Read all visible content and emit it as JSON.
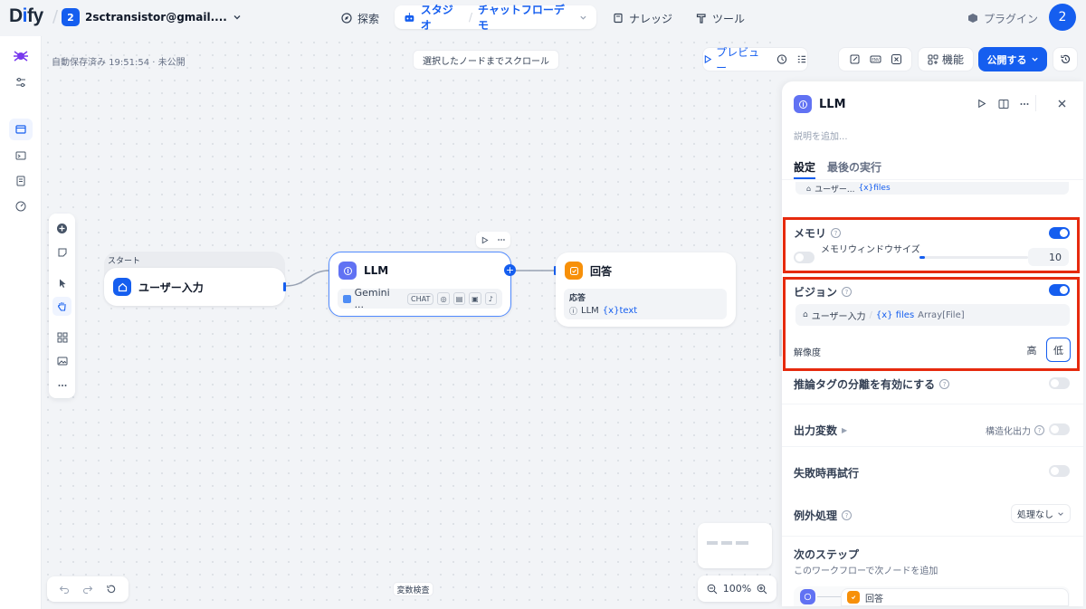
{
  "app": {
    "logo": "Dify"
  },
  "workspace": {
    "badge": "2",
    "name": "2sctransistor@gmail...."
  },
  "nav": {
    "explore": "探索",
    "studio": "スタジオ",
    "app_name": "チャットフローデモ",
    "knowledge": "ナレッジ",
    "tools": "ツール",
    "plugins": "プラグイン"
  },
  "user": {
    "avatar": "2"
  },
  "canvas": {
    "autosave": "自動保存済み 19:51:54 · 未公開",
    "scroll_to_node": "選択したノードまでスクロール",
    "var_inspect": "変数検査",
    "zoom": "100%"
  },
  "toolbar": {
    "preview": "プレビュー",
    "features": "機能",
    "publish": "公開する"
  },
  "nodes": {
    "start": {
      "header": "スタート",
      "title": "ユーザー入力"
    },
    "llm": {
      "title": "LLM",
      "model": "Gemini ...",
      "mode": "CHAT"
    },
    "answer": {
      "title": "回答",
      "field_label": "応答",
      "source": "LLM",
      "var": "{x}text"
    }
  },
  "panel": {
    "title": "LLM",
    "description_placeholder": "説明を追加...",
    "tabs": {
      "settings": "設定",
      "last_run": "最後の実行"
    },
    "context_snippet": {
      "node": "ユーザー...",
      "var": "{x}files"
    },
    "memory": {
      "label": "メモリ",
      "window_label": "メモリウィンドウサイズ",
      "window_value": "10",
      "window_fraction": 0.0
    },
    "vision": {
      "label": "ビジョン",
      "var_node": "ユーザー入力",
      "var_name": "{x} files",
      "var_type": "Array[File]",
      "resolution_label": "解像度",
      "high": "高",
      "low": "低"
    },
    "reasoning_tag": {
      "label": "推論タグの分離を有効にする"
    },
    "output_vars": {
      "label": "出力変数",
      "structured": "構造化出力"
    },
    "retry": {
      "label": "失敗時再試行"
    },
    "exception": {
      "label": "例外処理",
      "value": "処理なし"
    },
    "next_step": {
      "label": "次のステップ",
      "desc": "このワークフローで次ノードを追加",
      "node": "回答"
    }
  },
  "colors": {
    "accent": "#155eef",
    "highlight": "#e62a0e",
    "llm_icon": "#6172f3",
    "answer_icon": "#f79009"
  }
}
